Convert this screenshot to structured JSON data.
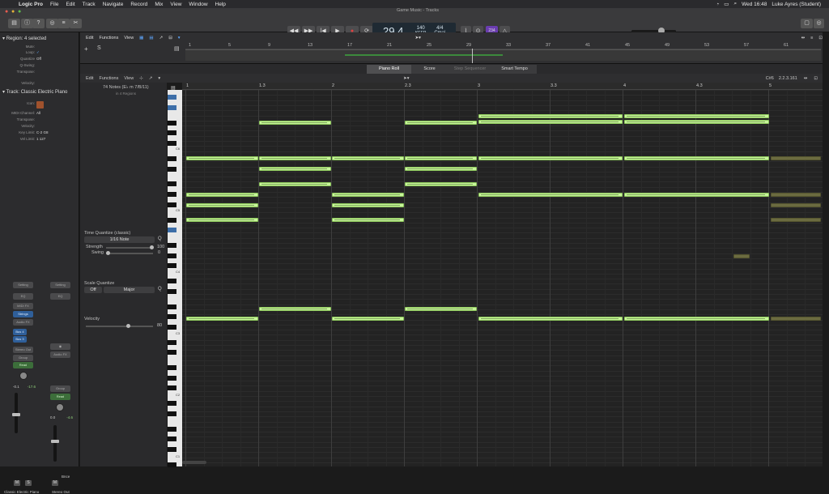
{
  "menubar": {
    "items": [
      "Logic Pro",
      "File",
      "Edit",
      "Track",
      "Navigate",
      "Record",
      "Mix",
      "View",
      "Window",
      "Help"
    ],
    "clock": "Wed 16:48",
    "user": "Luke Ayres (Student)"
  },
  "window": {
    "title": "Game Music - Tracks"
  },
  "transport": {
    "position": "29.4",
    "position_sub": "BAR",
    "tempo": "140",
    "tempo_sub": "KEEP",
    "time_signature": "4/4",
    "key": "Cmaj",
    "count_in": "234"
  },
  "inspector": {
    "region_header": "Region: 4 selected",
    "region_rows": [
      {
        "k": "Mute:",
        "v": ""
      },
      {
        "k": "Loop:",
        "v": "✓"
      },
      {
        "k": "Quantize",
        "v": "Off"
      },
      {
        "k": "Q-Swing:",
        "v": ""
      },
      {
        "k": "Transpose:",
        "v": ""
      },
      {
        "k": "Velocity:",
        "v": ""
      }
    ],
    "track_header": "Track: Classic Electric Piano",
    "track_rows": [
      {
        "k": "Icon:",
        "v": ""
      },
      {
        "k": "MIDI Channel:",
        "v": "All"
      },
      {
        "k": "Transpose:",
        "v": ""
      },
      {
        "k": "Velocity:",
        "v": ""
      },
      {
        "k": "Key Limit:",
        "v": "C-2  G8"
      },
      {
        "k": "Vel Limit:",
        "v": "1  127"
      }
    ],
    "strip1": {
      "setting": "Setting",
      "eq": "EQ",
      "midi_fx": "MIDI FX",
      "instrument": "Strings",
      "audio_fx": "Audio FX",
      "bus1": "Bus 4",
      "bus2": "Bus 3",
      "output": "Stereo Out",
      "group": "Group",
      "automation": "Read",
      "vol_a": "-0.1",
      "vol_b": "-17.6",
      "name": "Classic Electric Piano",
      "m": "M",
      "s": "S"
    },
    "strip2": {
      "setting": "Setting",
      "eq": "EQ",
      "audio_fx": "Audio FX",
      "group": "Group",
      "automation": "Read",
      "vol_a": "0.0",
      "vol_b": "-4.6",
      "name": "Stereo Out",
      "m": "M",
      "bnce": "Bnce"
    }
  },
  "tracks_bar": {
    "edit": "Edit",
    "functions": "Functions",
    "view": "View",
    "ruler_ticks": [
      "1",
      "5",
      "9",
      "13",
      "17",
      "21",
      "25",
      "29",
      "33",
      "37",
      "41",
      "45",
      "49",
      "53",
      "57",
      "61"
    ]
  },
  "tabs": [
    "Piano Roll",
    "Score",
    "Step Sequencer",
    "Smart Tempo"
  ],
  "piano_roll": {
    "edit": "Edit",
    "functions": "Functions",
    "view": "View",
    "position_label": "C#6",
    "position_value": "2.2.3.161",
    "ruler_ticks": [
      "1",
      "1.3",
      "2",
      "2.3",
      "3",
      "3.3",
      "4",
      "4.3",
      "5"
    ]
  },
  "local_inspector": {
    "note_count": "74 Notes (E♭ m 7/B/11)",
    "regions": "in 4 Regions",
    "time_quantize_title": "Time Quantize (classic)",
    "quantize_value": "1/16 Note",
    "q_button": "Q",
    "strength_label": "Strength",
    "strength_value": "100",
    "swing_label": "Swing",
    "swing_value": "0",
    "scale_quantize_title": "Scale Quantize",
    "scale_off": "Off",
    "scale_mode": "Major",
    "velocity_title": "Velocity",
    "velocity_value": "80"
  },
  "keyboard": {
    "labels": [
      "C6",
      "C5",
      "C4",
      "C3",
      "C2",
      "C1"
    ]
  }
}
